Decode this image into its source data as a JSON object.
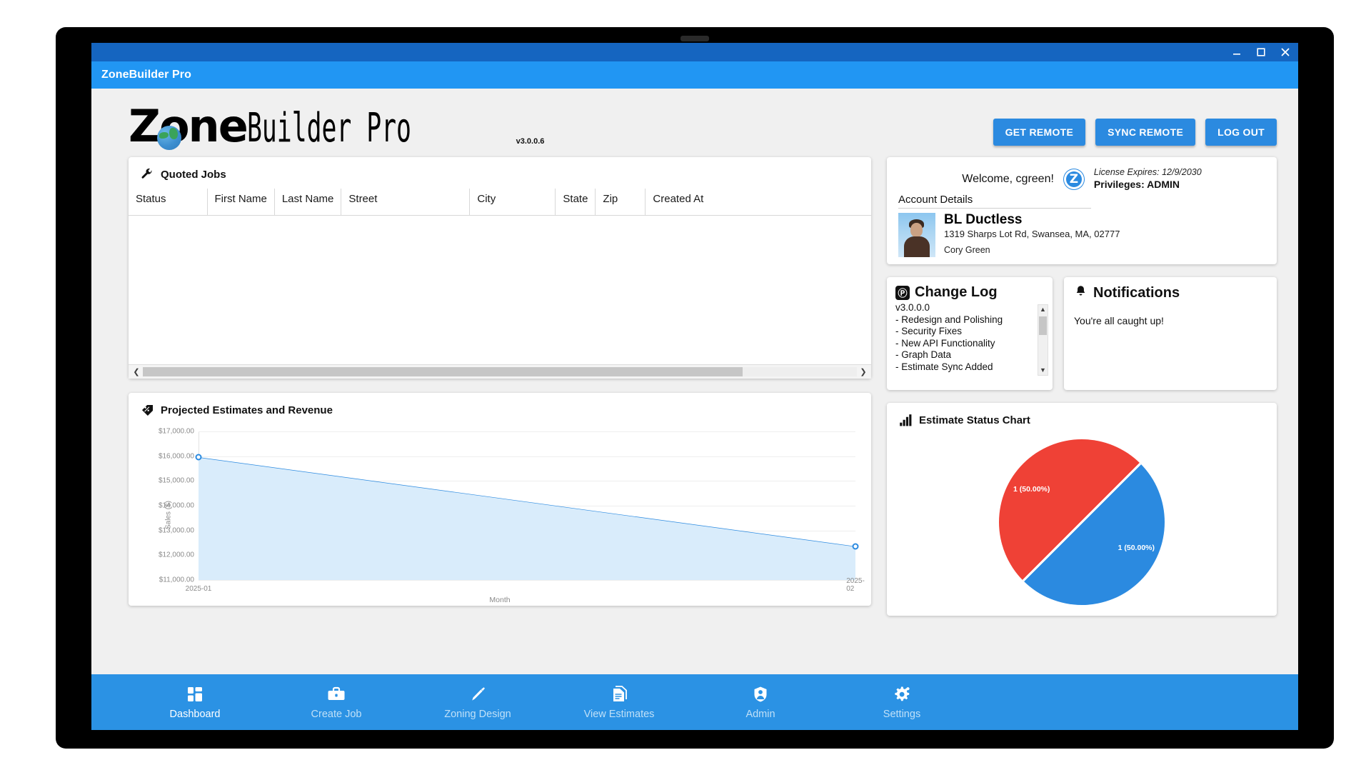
{
  "window": {
    "title": "ZoneBuilder Pro",
    "controls": [
      "minimize-icon",
      "maximize-icon",
      "close-icon"
    ]
  },
  "brand": {
    "word_one": "Zone",
    "word_two": "Builder Pro",
    "version": "v3.0.0.6",
    "accent_color": "#2b8ae0"
  },
  "header_buttons": [
    {
      "label": "GET REMOTE",
      "name": "get-remote-button"
    },
    {
      "label": "SYNC REMOTE",
      "name": "sync-remote-button"
    },
    {
      "label": "LOG OUT",
      "name": "log-out-button"
    }
  ],
  "quoted_jobs": {
    "title": "Quoted Jobs",
    "icon": "wrench-icon",
    "columns": [
      "Status",
      "First Name",
      "Last Name",
      "Street",
      "City",
      "State",
      "Zip",
      "Created At"
    ],
    "rows": [],
    "scroll_left_icon": "chevron-left-icon",
    "scroll_right_icon": "chevron-right-icon"
  },
  "account": {
    "welcome": "Welcome, cgreen!",
    "badge_letter": "Z",
    "license_expires": "License Expires: 12/9/2030",
    "privileges": "Privileges: ADMIN",
    "details_label": "Account Details",
    "company": "BL Ductless",
    "address": "1319 Sharps Lot Rd, Swansea, MA, 02777",
    "user_name": "Cory Green"
  },
  "change_log": {
    "title": "Change Log",
    "icon": "changelog-icon",
    "version": "v3.0.0.0",
    "entries": [
      "- Redesign and Polishing",
      "- Security Fixes",
      "- New API Functionality",
      "- Graph Data",
      "- Estimate Sync Added"
    ],
    "scroll_up_icon": "chevron-up-icon",
    "scroll_down_icon": "chevron-down-icon"
  },
  "notifications": {
    "title": "Notifications",
    "icon": "bell-icon",
    "body": "You're all caught up!"
  },
  "line_panel": {
    "title": "Projected Estimates and Revenue",
    "icon": "price-tag-icon"
  },
  "pie_panel": {
    "title": "Estimate Status Chart",
    "icon": "bar-chart-icon"
  },
  "chart_data": [
    {
      "type": "area",
      "title": "Projected Estimates and Revenue",
      "xlabel": "Month",
      "ylabel": "Sales ($)",
      "categories": [
        "2025-01",
        "2025-02"
      ],
      "series": [
        {
          "name": "Sales",
          "values": [
            15950,
            12350
          ]
        }
      ],
      "ytick_labels": [
        "$17,000.00",
        "$16,000.00",
        "$15,000.00",
        "$14,000.00",
        "$13,000.00",
        "$12,000.00",
        "$11,000.00"
      ],
      "ytick_values": [
        17000,
        16000,
        15000,
        14000,
        13000,
        12000,
        11000
      ],
      "ylim": [
        11000,
        17000
      ],
      "grid": true,
      "legend": "none",
      "line_color": "#2b8ae0",
      "fill_color": "#d9ecfb"
    },
    {
      "type": "pie",
      "title": "Estimate Status Chart",
      "slices": [
        {
          "label": "1 (50.00%)",
          "value": 1,
          "percent": 50.0,
          "color": "#ef4136"
        },
        {
          "label": "1 (50.00%)",
          "value": 1,
          "percent": 50.0,
          "color": "#2b8ae0"
        }
      ],
      "legend": "none"
    }
  ],
  "bottom_nav": [
    {
      "label": "Dashboard",
      "icon": "dashboard-icon",
      "active": true
    },
    {
      "label": "Create Job",
      "icon": "briefcase-icon",
      "active": false
    },
    {
      "label": "Zoning Design",
      "icon": "pen-icon",
      "active": false
    },
    {
      "label": "View Estimates",
      "icon": "document-icon",
      "active": false
    },
    {
      "label": "Admin",
      "icon": "shield-user-icon",
      "active": false
    },
    {
      "label": "Settings",
      "icon": "gear-icon",
      "active": false
    }
  ]
}
